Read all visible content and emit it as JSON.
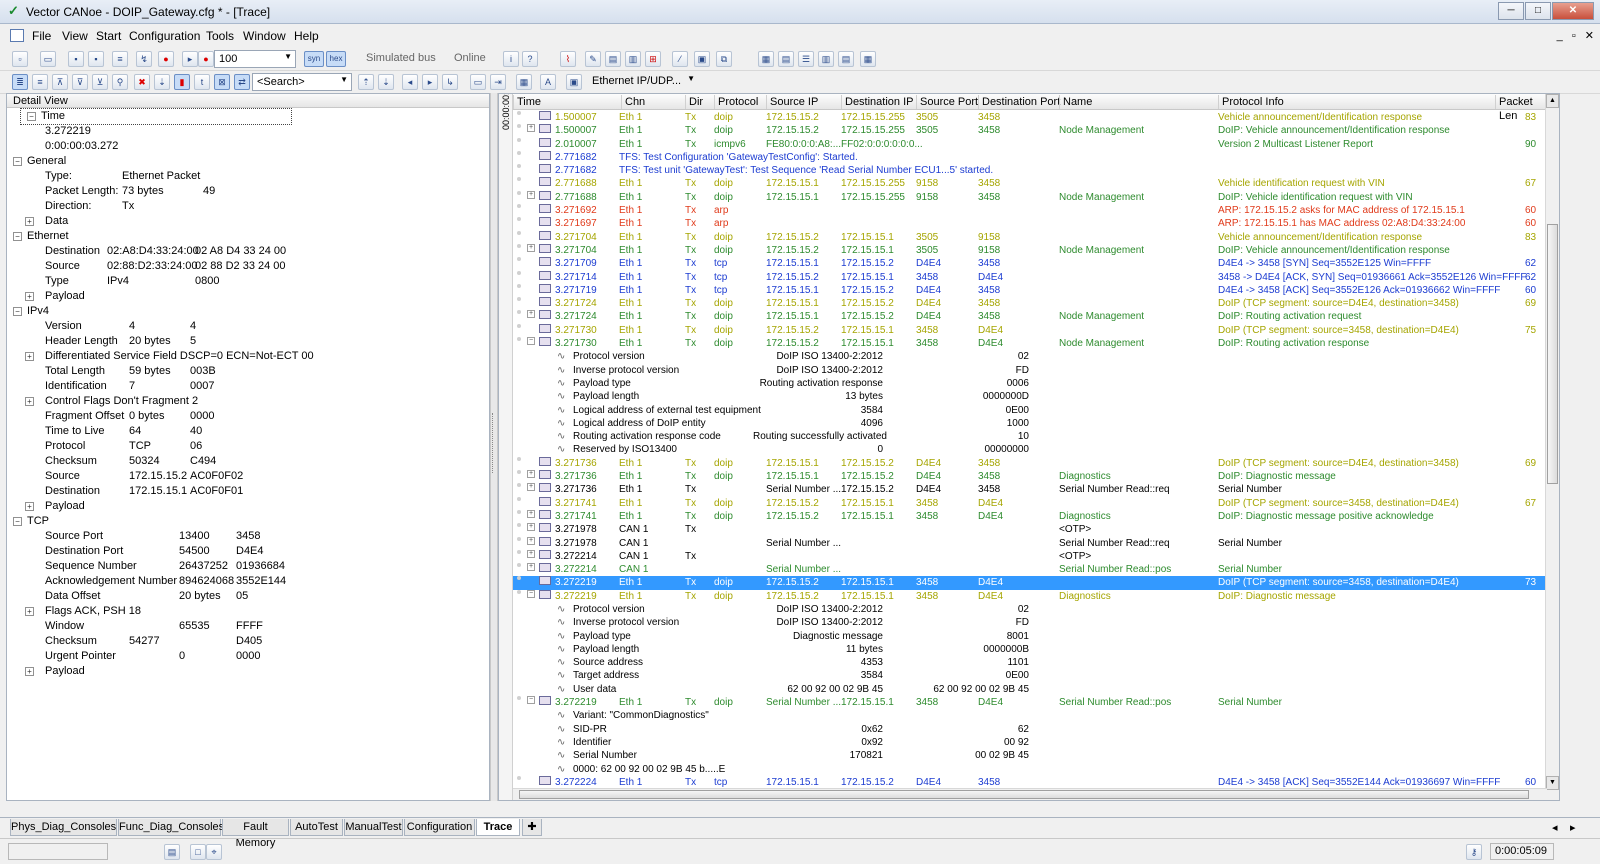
{
  "window": {
    "title": "Vector CANoe  - DOIP_Gateway.cfg * - [Trace]",
    "min": "─",
    "max": "□",
    "close": "✕"
  },
  "menu": [
    "File",
    "View",
    "Start",
    "Configuration",
    "Tools",
    "Window",
    "Help"
  ],
  "mdi_controls": "_ ▫ ✕",
  "toolbar1": {
    "speed_value": "100",
    "syn": "syn",
    "hex": "hex",
    "simulated_bus": "Simulated bus",
    "online": "Online"
  },
  "toolbar2": {
    "search_placeholder": "<Search>",
    "filter_combo": "Ethernet IP/UDP..."
  },
  "detail_view": {
    "title": "Detail View",
    "rows": [
      {
        "d": 0,
        "e": "−",
        "k": "Time",
        "v1": "",
        "v2": ""
      },
      {
        "d": 1,
        "e": "",
        "k": "3.272219",
        "v1": "",
        "v2": ""
      },
      {
        "d": 1,
        "e": "",
        "k": "0:00:00:03.272",
        "v1": "",
        "v2": ""
      },
      {
        "d": 0,
        "e": "−",
        "k": "General",
        "v1": "",
        "v2": ""
      },
      {
        "d": 1,
        "e": "",
        "k": "Type:",
        "v1": "Ethernet Packet",
        "v2": ""
      },
      {
        "d": 1,
        "e": "",
        "k": "Packet Length:",
        "v1": "73 bytes",
        "v2": "49"
      },
      {
        "d": 1,
        "e": "",
        "k": "Direction:",
        "v1": "Tx",
        "v2": ""
      },
      {
        "d": 1,
        "e": "+",
        "k": "Data",
        "v1": "",
        "v2": ""
      },
      {
        "d": 0,
        "e": "−",
        "k": "Ethernet",
        "v1": "",
        "v2": ""
      },
      {
        "d": 1,
        "e": "",
        "k": "Destination",
        "v1": "02:A8:D4:33:24:00",
        "v2": "02  A8  D4  33  24  00"
      },
      {
        "d": 1,
        "e": "",
        "k": "Source",
        "v1": "02:88:D2:33:24:00",
        "v2": "02  88  D2  33  24  00"
      },
      {
        "d": 1,
        "e": "",
        "k": "Type",
        "v1": "IPv4",
        "v2": "0800"
      },
      {
        "d": 1,
        "e": "+",
        "k": "Payload",
        "v1": "",
        "v2": ""
      },
      {
        "d": 0,
        "e": "−",
        "k": "IPv4",
        "v1": "",
        "v2": ""
      },
      {
        "d": 1,
        "e": "",
        "k": "Version",
        "v1": "4",
        "v2": "4"
      },
      {
        "d": 1,
        "e": "",
        "k": "Header Length",
        "v1": "20 bytes",
        "v2": "5"
      },
      {
        "d": 1,
        "e": "+",
        "k": "Differentiated Service Field   DSCP=0 ECN=Not-ECT   00",
        "v1": "",
        "v2": ""
      },
      {
        "d": 1,
        "e": "",
        "k": "Total Length",
        "v1": "59 bytes",
        "v2": "003B"
      },
      {
        "d": 1,
        "e": "",
        "k": "Identification",
        "v1": "7",
        "v2": "0007"
      },
      {
        "d": 1,
        "e": "+",
        "k": "Control Flags    Don't Fragment   2",
        "v1": "",
        "v2": ""
      },
      {
        "d": 1,
        "e": "",
        "k": "Fragment Offset",
        "v1": "0 bytes",
        "v2": "0000"
      },
      {
        "d": 1,
        "e": "",
        "k": "Time to Live",
        "v1": "64",
        "v2": "40"
      },
      {
        "d": 1,
        "e": "",
        "k": "Protocol",
        "v1": "TCP",
        "v2": "06"
      },
      {
        "d": 1,
        "e": "",
        "k": "Checksum",
        "v1": "50324",
        "v2": "C494"
      },
      {
        "d": 1,
        "e": "",
        "k": "Source",
        "v1": "172.15.15.2",
        "v2": "AC0F0F02"
      },
      {
        "d": 1,
        "e": "",
        "k": "Destination",
        "v1": "172.15.15.1",
        "v2": "AC0F0F01"
      },
      {
        "d": 1,
        "e": "+",
        "k": "Payload",
        "v1": "",
        "v2": ""
      },
      {
        "d": 0,
        "e": "−",
        "k": "TCP",
        "v1": "",
        "v2": ""
      },
      {
        "d": 1,
        "e": "",
        "k": "Source Port",
        "v1": "13400",
        "v2": "3458"
      },
      {
        "d": 1,
        "e": "",
        "k": "Destination Port",
        "v1": "54500",
        "v2": "D4E4"
      },
      {
        "d": 1,
        "e": "",
        "k": "Sequence Number",
        "v1": "26437252",
        "v2": "01936684"
      },
      {
        "d": 1,
        "e": "",
        "k": "Acknowledgement Number",
        "v1": "894624068",
        "v2": "3552E144"
      },
      {
        "d": 1,
        "e": "",
        "k": "Data Offset",
        "v1": "20 bytes",
        "v2": "05"
      },
      {
        "d": 1,
        "e": "+",
        "k": "Flags    ACK, PSH   18",
        "v1": "",
        "v2": ""
      },
      {
        "d": 1,
        "e": "",
        "k": "Window",
        "v1": "65535",
        "v2": "FFFF"
      },
      {
        "d": 1,
        "e": "",
        "k": "Checksum",
        "v1": "54277",
        "v2": "D405"
      },
      {
        "d": 1,
        "e": "",
        "k": "Urgent Pointer",
        "v1": "0",
        "v2": "0000"
      },
      {
        "d": 1,
        "e": "+",
        "k": "Payload",
        "v1": "",
        "v2": ""
      }
    ]
  },
  "trace": {
    "side_label": "00:00:00:00",
    "columns": [
      "Time",
      "Chn",
      "Dir",
      "Protocol",
      "Source IP",
      "Destination IP",
      "Source Port",
      "Destination Port",
      "Name",
      "Protocol Info",
      "Packet Len"
    ],
    "rows": [
      {
        "k": "m",
        "c": "olive",
        "t": "1.500007",
        "ch": "Eth 1",
        "dir": "Tx",
        "p": "doip",
        "sip": "172.15.15.2",
        "dip": "172.15.15.255",
        "sp": "3505",
        "dp": "3458",
        "n": "",
        "info": "Vehicle announcement/Identification response",
        "len": "83"
      },
      {
        "k": "m",
        "c": "green",
        "e": "+",
        "t": "1.500007",
        "ch": "Eth 1",
        "dir": "Tx",
        "p": "doip",
        "sip": "172.15.15.2",
        "dip": "172.15.15.255",
        "sp": "3505",
        "dp": "3458",
        "n": "Node Management",
        "info": "DoIP: Vehicle announcement/Identification response",
        "len": ""
      },
      {
        "k": "m",
        "c": "green",
        "t": "2.010007",
        "ch": "Eth 1",
        "dir": "Tx",
        "p": "icmpv6",
        "sip": "FE80:0:0:0:A8:...",
        "dip": "FF02:0:0:0:0:0:0...",
        "sp": "",
        "dp": "",
        "n": "",
        "info": "Version 2 Multicast Listener Report",
        "len": "90"
      },
      {
        "k": "m",
        "c": "blue",
        "t": "2.771682",
        "ch": "TFS: Test Configuration 'GatewayTestConfig': Started.",
        "dir": "",
        "p": "",
        "sip": "",
        "dip": "",
        "sp": "",
        "dp": "",
        "n": "",
        "info": "",
        "len": ""
      },
      {
        "k": "m",
        "c": "blue",
        "t": "2.771682",
        "ch": "TFS: Test unit 'GatewayTest': Test Sequence 'Read Serial Number ECU1...5' started.",
        "dir": "",
        "p": "",
        "sip": "",
        "dip": "",
        "sp": "",
        "dp": "",
        "n": "",
        "info": "",
        "len": ""
      },
      {
        "k": "m",
        "c": "olive",
        "t": "2.771688",
        "ch": "Eth 1",
        "dir": "Tx",
        "p": "doip",
        "sip": "172.15.15.1",
        "dip": "172.15.15.255",
        "sp": "9158",
        "dp": "3458",
        "n": "",
        "info": "Vehicle identification request with VIN",
        "len": "67"
      },
      {
        "k": "m",
        "c": "green",
        "e": "+",
        "t": "2.771688",
        "ch": "Eth 1",
        "dir": "Tx",
        "p": "doip",
        "sip": "172.15.15.1",
        "dip": "172.15.15.255",
        "sp": "9158",
        "dp": "3458",
        "n": "Node Management",
        "info": "DoIP: Vehicle identification request with VIN",
        "len": ""
      },
      {
        "k": "m",
        "c": "red",
        "t": "3.271692",
        "ch": "Eth 1",
        "dir": "Tx",
        "p": "arp",
        "sip": "",
        "dip": "",
        "sp": "",
        "dp": "",
        "n": "",
        "info": "ARP: 172.15.15.2 asks for MAC address of 172.15.15.1",
        "len": "60"
      },
      {
        "k": "m",
        "c": "red",
        "t": "3.271697",
        "ch": "Eth 1",
        "dir": "Tx",
        "p": "arp",
        "sip": "",
        "dip": "",
        "sp": "",
        "dp": "",
        "n": "",
        "info": "ARP: 172.15.15.1 has MAC address 02:A8:D4:33:24:00",
        "len": "60"
      },
      {
        "k": "m",
        "c": "olive",
        "t": "3.271704",
        "ch": "Eth 1",
        "dir": "Tx",
        "p": "doip",
        "sip": "172.15.15.2",
        "dip": "172.15.15.1",
        "sp": "3505",
        "dp": "9158",
        "n": "",
        "info": "Vehicle announcement/Identification response",
        "len": "83"
      },
      {
        "k": "m",
        "c": "green",
        "e": "+",
        "t": "3.271704",
        "ch": "Eth 1",
        "dir": "Tx",
        "p": "doip",
        "sip": "172.15.15.2",
        "dip": "172.15.15.1",
        "sp": "3505",
        "dp": "9158",
        "n": "Node Management",
        "info": "DoIP: Vehicle announcement/Identification response",
        "len": ""
      },
      {
        "k": "m",
        "c": "blue",
        "t": "3.271709",
        "ch": "Eth 1",
        "dir": "Tx",
        "p": "tcp",
        "sip": "172.15.15.1",
        "dip": "172.15.15.2",
        "sp": "D4E4",
        "dp": "3458",
        "n": "",
        "info": "D4E4 -> 3458 [SYN] Seq=3552E125 Win=FFFF",
        "len": "62"
      },
      {
        "k": "m",
        "c": "blue",
        "t": "3.271714",
        "ch": "Eth 1",
        "dir": "Tx",
        "p": "tcp",
        "sip": "172.15.15.2",
        "dip": "172.15.15.1",
        "sp": "3458",
        "dp": "D4E4",
        "n": "",
        "info": "3458 -> D4E4 [ACK, SYN] Seq=01936661 Ack=3552E126 Win=FFFF",
        "len": "62"
      },
      {
        "k": "m",
        "c": "blue",
        "t": "3.271719",
        "ch": "Eth 1",
        "dir": "Tx",
        "p": "tcp",
        "sip": "172.15.15.1",
        "dip": "172.15.15.2",
        "sp": "D4E4",
        "dp": "3458",
        "n": "",
        "info": "D4E4 -> 3458 [ACK] Seq=3552E126 Ack=01936662 Win=FFFF",
        "len": "60"
      },
      {
        "k": "m",
        "c": "olive",
        "t": "3.271724",
        "ch": "Eth 1",
        "dir": "Tx",
        "p": "doip",
        "sip": "172.15.15.1",
        "dip": "172.15.15.2",
        "sp": "D4E4",
        "dp": "3458",
        "n": "",
        "info": "DoIP (TCP segment: source=D4E4, destination=3458)",
        "len": "69"
      },
      {
        "k": "m",
        "c": "green",
        "e": "+",
        "t": "3.271724",
        "ch": "Eth 1",
        "dir": "Tx",
        "p": "doip",
        "sip": "172.15.15.1",
        "dip": "172.15.15.2",
        "sp": "D4E4",
        "dp": "3458",
        "n": "Node Management",
        "info": "DoIP: Routing activation request",
        "len": ""
      },
      {
        "k": "m",
        "c": "olive",
        "t": "3.271730",
        "ch": "Eth 1",
        "dir": "Tx",
        "p": "doip",
        "sip": "172.15.15.2",
        "dip": "172.15.15.1",
        "sp": "3458",
        "dp": "D4E4",
        "n": "",
        "info": "DoIP (TCP segment: source=3458, destination=D4E4)",
        "len": "75"
      },
      {
        "k": "m",
        "c": "green",
        "e": "−",
        "t": "3.271730",
        "ch": "Eth 1",
        "dir": "Tx",
        "p": "doip",
        "sip": "172.15.15.2",
        "dip": "172.15.15.1",
        "sp": "3458",
        "dp": "D4E4",
        "n": "Node Management",
        "info": "DoIP: Routing activation response",
        "len": ""
      },
      {
        "k": "s",
        "a": "Protocol version",
        "b": "DoIP ISO 13400-2:2012",
        "h": "02"
      },
      {
        "k": "s",
        "a": "Inverse protocol version",
        "b": "DoIP ISO 13400-2:2012",
        "h": "FD"
      },
      {
        "k": "s",
        "a": "Payload type",
        "b": "Routing activation response",
        "h": "0006"
      },
      {
        "k": "s",
        "a": "Payload length",
        "b": "13  bytes",
        "h": "0000000D"
      },
      {
        "k": "s",
        "a": "Logical address of external test equipment",
        "b": "3584",
        "h": "0E00"
      },
      {
        "k": "s",
        "a": "Logical address of DoIP entity",
        "b": "4096",
        "h": "1000"
      },
      {
        "k": "s",
        "a": "Routing activation response code",
        "b": "Routing successfully activated",
        "h": "10"
      },
      {
        "k": "s",
        "a": "Reserved by ISO13400",
        "b": "0",
        "h": "00000000"
      },
      {
        "k": "m",
        "c": "olive",
        "t": "3.271736",
        "ch": "Eth 1",
        "dir": "Tx",
        "p": "doip",
        "sip": "172.15.15.1",
        "dip": "172.15.15.2",
        "sp": "D4E4",
        "dp": "3458",
        "n": "",
        "info": "DoIP (TCP segment: source=D4E4, destination=3458)",
        "len": "69"
      },
      {
        "k": "m",
        "c": "green",
        "e": "+",
        "t": "3.271736",
        "ch": "Eth 1",
        "dir": "Tx",
        "p": "doip",
        "sip": "172.15.15.1",
        "dip": "172.15.15.2",
        "sp": "D4E4",
        "dp": "3458",
        "n": "Diagnostics",
        "info": "DoIP: Diagnostic message",
        "len": ""
      },
      {
        "k": "m",
        "c": "black",
        "e": "+",
        "t": "3.271736",
        "ch": "Eth 1",
        "dir": "Tx",
        "p": "",
        "sip": "Serial Number ...",
        "dip": "172.15.15.2",
        "sp": "D4E4",
        "dp": "3458",
        "n": "Serial Number Read::req",
        "info": "Serial Number",
        "len": ""
      },
      {
        "k": "m",
        "c": "olive",
        "t": "3.271741",
        "ch": "Eth 1",
        "dir": "Tx",
        "p": "doip",
        "sip": "172.15.15.2",
        "dip": "172.15.15.1",
        "sp": "3458",
        "dp": "D4E4",
        "n": "",
        "info": "DoIP (TCP segment: source=3458, destination=D4E4)",
        "len": "67"
      },
      {
        "k": "m",
        "c": "green",
        "e": "+",
        "t": "3.271741",
        "ch": "Eth 1",
        "dir": "Tx",
        "p": "doip",
        "sip": "172.15.15.2",
        "dip": "172.15.15.1",
        "sp": "3458",
        "dp": "D4E4",
        "n": "Diagnostics",
        "info": "DoIP: Diagnostic message positive acknowledge",
        "len": ""
      },
      {
        "k": "m",
        "c": "black",
        "e": "+",
        "t": "3.271978",
        "ch": "CAN 1",
        "dir": "Tx",
        "p": "",
        "sip": "",
        "dip": "",
        "sp": "",
        "dp": "",
        "n": "<OTP>",
        "info": "",
        "len": ""
      },
      {
        "k": "m",
        "c": "black",
        "e": "+",
        "t": "3.271978",
        "ch": "CAN 1",
        "dir": "",
        "p": "",
        "sip": "Serial Number ...",
        "dip": "",
        "sp": "",
        "dp": "",
        "n": "Serial Number Read::req",
        "info": "Serial Number",
        "len": ""
      },
      {
        "k": "m",
        "c": "black",
        "e": "+",
        "t": "3.272214",
        "ch": "CAN 1",
        "dir": "Tx",
        "p": "",
        "sip": "",
        "dip": "",
        "sp": "",
        "dp": "",
        "n": "<OTP>",
        "info": "",
        "len": ""
      },
      {
        "k": "m",
        "c": "green",
        "e": "+",
        "t": "3.272214",
        "ch": "CAN 1",
        "dir": "",
        "p": "",
        "sip": "Serial Number ...",
        "dip": "",
        "sp": "",
        "dp": "",
        "n": "Serial Number Read::pos",
        "info": "Serial Number",
        "len": ""
      },
      {
        "k": "m",
        "c": "sel",
        "t": "3.272219",
        "ch": "Eth 1",
        "dir": "Tx",
        "p": "doip",
        "sip": "172.15.15.2",
        "dip": "172.15.15.1",
        "sp": "3458",
        "dp": "D4E4",
        "n": "",
        "info": "DoIP (TCP segment: source=3458, destination=D4E4)",
        "len": "73"
      },
      {
        "k": "m",
        "c": "olive",
        "e": "−",
        "t": "3.272219",
        "ch": "Eth 1",
        "dir": "Tx",
        "p": "doip",
        "sip": "172.15.15.2",
        "dip": "172.15.15.1",
        "sp": "3458",
        "dp": "D4E4",
        "n": "Diagnostics",
        "info": "DoIP: Diagnostic message",
        "len": ""
      },
      {
        "k": "s",
        "a": "Protocol version",
        "b": "DoIP ISO 13400-2:2012",
        "h": "02"
      },
      {
        "k": "s",
        "a": "Inverse protocol version",
        "b": "DoIP ISO 13400-2:2012",
        "h": "FD"
      },
      {
        "k": "s",
        "a": "Payload type",
        "b": "Diagnostic message",
        "h": "8001"
      },
      {
        "k": "s",
        "a": "Payload length",
        "b": "11  bytes",
        "h": "0000000B"
      },
      {
        "k": "s",
        "a": "Source address",
        "b": "4353",
        "h": "1101"
      },
      {
        "k": "s",
        "a": "Target address",
        "b": "3584",
        "h": "0E00"
      },
      {
        "k": "s",
        "a": "User data",
        "b": "62 00 92 00 02 9B 45",
        "h": "62 00 92 00 02 9B 45"
      },
      {
        "k": "m",
        "c": "green",
        "e": "−",
        "t": "3.272219",
        "ch": "Eth 1",
        "dir": "Tx",
        "p": "doip",
        "sip": "Serial Number ...",
        "dip": "172.15.15.1",
        "sp": "3458",
        "dp": "D4E4",
        "n": "Serial Number Read::pos",
        "info": "Serial Number",
        "len": ""
      },
      {
        "k": "s",
        "a": "Variant: \"CommonDiagnostics\"",
        "b": "",
        "h": ""
      },
      {
        "k": "s",
        "a": "SID-PR",
        "b": "0x62",
        "h": "62"
      },
      {
        "k": "s",
        "a": "Identifier",
        "b": "0x92",
        "h": "00 92"
      },
      {
        "k": "s",
        "a": "Serial Number",
        "b": "170821",
        "h": "00 02 9B 45"
      },
      {
        "k": "s",
        "a": "0000:      62 00 92 00 02 9B 45          b.....E",
        "b": "",
        "h": ""
      },
      {
        "k": "m",
        "c": "blue",
        "t": "3.272224",
        "ch": "Eth 1",
        "dir": "Tx",
        "p": "tcp",
        "sip": "172.15.15.1",
        "dip": "172.15.15.2",
        "sp": "D4E4",
        "dp": "3458",
        "n": "",
        "info": "D4E4 -> 3458 [ACK] Seq=3552E144 Ack=01936697 Win=FFFF",
        "len": "60"
      }
    ]
  },
  "tabs": [
    "Phys_Diag_Consoles",
    "Func_Diag_Consoles",
    "Fault Memory",
    "AutoTest",
    "ManualTest",
    "Configuration",
    "Trace"
  ],
  "active_tab": "Trace",
  "status": {
    "clock": "0:00:05:09"
  }
}
